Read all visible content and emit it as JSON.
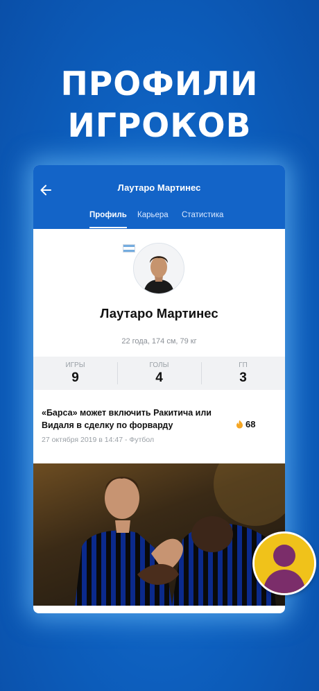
{
  "promo": {
    "line1": "ПРОФИЛИ",
    "line2": "ИГРОКОВ"
  },
  "header": {
    "title": "Лаутаро Мартинес",
    "back_icon": "arrow-left-icon"
  },
  "tabs": [
    {
      "label": "Профиль",
      "active": true
    },
    {
      "label": "Карьера",
      "active": false
    },
    {
      "label": "Статистика",
      "active": false
    }
  ],
  "player": {
    "name": "Лаутаро Мартинес",
    "meta": "22 года, 174 см, 79 кг",
    "flag": "argentina-flag-icon"
  },
  "stats": [
    {
      "label": "ИГРЫ",
      "value": "9"
    },
    {
      "label": "ГОЛЫ",
      "value": "4"
    },
    {
      "label": "ГП",
      "value": "3"
    }
  ],
  "news": {
    "title": "«Барса» может включить Ракитича или Видаля в сделку по форварду",
    "heat_count": "68",
    "heat_icon": "fire-icon",
    "date": "27 октября 2019 в 14:47 - Футбол"
  },
  "colors": {
    "brand_blue": "#1364c8",
    "background": "#0d5fbe",
    "fire": "#f5a623",
    "fab": "#f0c21a",
    "fab_silhouette": "#7b2d6a"
  }
}
